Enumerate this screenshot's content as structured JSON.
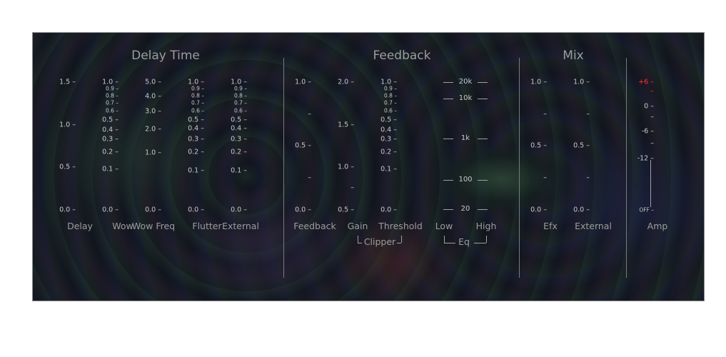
{
  "sections": [
    {
      "id": "delay-time",
      "title": "Delay Time"
    },
    {
      "id": "feedback",
      "title": "Feedback"
    },
    {
      "id": "mix",
      "title": "Mix"
    }
  ],
  "controls": [
    {
      "id": "delay",
      "label": "Delay",
      "ticks": [
        {
          "t": "1.5 –"
        },
        {
          "t": "1.0 –"
        },
        {
          "t": "0.5 –"
        },
        {
          "t": "0.0 –"
        }
      ]
    },
    {
      "id": "wow",
      "label": "Wow",
      "ticks": [
        {
          "t": "1.0 –"
        },
        {
          "t": "0.9 –"
        },
        {
          "t": "0.8 –"
        },
        {
          "t": "0.7 –"
        },
        {
          "t": "0.6 –"
        },
        {
          "t": "0.5 –"
        },
        {
          "t": "0.4 –"
        },
        {
          "t": "0.3 –"
        },
        {
          "t": "0.2 –"
        },
        {
          "t": "0.1 –"
        },
        {
          "t": "0.0 –"
        }
      ]
    },
    {
      "id": "wow-freq",
      "label": "Wow Freq",
      "ticks": [
        {
          "t": "5.0 –"
        },
        {
          "t": "4.0 –"
        },
        {
          "t": "3.0 –"
        },
        {
          "t": "2.0 –"
        },
        {
          "t": "1.0 –"
        },
        {
          "t": "0.0 –"
        }
      ]
    },
    {
      "id": "flutter",
      "label": "Flutter",
      "ticks": [
        {
          "t": "1.0 –"
        },
        {
          "t": "0.9 –"
        },
        {
          "t": "0.8 –"
        },
        {
          "t": "0.7 –"
        },
        {
          "t": "0.6 –"
        },
        {
          "t": "0.5 –"
        },
        {
          "t": "0.4 –"
        },
        {
          "t": "0.3 –"
        },
        {
          "t": "0.2 –"
        },
        {
          "t": "0.1 –"
        },
        {
          "t": "0.0 –"
        }
      ]
    },
    {
      "id": "external-delay",
      "label": "External",
      "ticks": [
        {
          "t": "1.0 –"
        },
        {
          "t": "0.9 –"
        },
        {
          "t": "0.8 –"
        },
        {
          "t": "0.7 –"
        },
        {
          "t": "0.6 –"
        },
        {
          "t": "0.5 –"
        },
        {
          "t": "0.4 –"
        },
        {
          "t": "0.3 –"
        },
        {
          "t": "0.2 –"
        },
        {
          "t": "0.1 –"
        },
        {
          "t": "0.0 –"
        }
      ]
    },
    {
      "id": "feedback",
      "label": "Feedback",
      "ticks": [
        {
          "t": "1.0 –"
        },
        {
          "t": "–"
        },
        {
          "t": "0.5 –"
        },
        {
          "t": "–"
        },
        {
          "t": "0.0 –"
        }
      ]
    },
    {
      "id": "gain",
      "label": "Gain",
      "ticks": [
        {
          "t": "2.0 –"
        },
        {
          "t": "1.5 –"
        },
        {
          "t": "1.0 –"
        },
        {
          "t": "–"
        },
        {
          "t": "0.5 –"
        }
      ]
    },
    {
      "id": "threshold",
      "label": "Threshold",
      "ticks": [
        {
          "t": "1.0 –"
        },
        {
          "t": "0.9 –"
        },
        {
          "t": "0.8 –"
        },
        {
          "t": "0.7 –"
        },
        {
          "t": "0.6 –"
        },
        {
          "t": "0.5 –"
        },
        {
          "t": "0.4 –"
        },
        {
          "t": "0.3 –"
        },
        {
          "t": "0.2 –"
        },
        {
          "t": "0.1 –"
        },
        {
          "t": "0.0 –"
        }
      ]
    },
    {
      "id": "eq",
      "label_low": "Low",
      "label_high": "High",
      "ticks": [
        {
          "t": "20k"
        },
        {
          "t": "10k"
        },
        {
          "t": "1k"
        },
        {
          "t": "100"
        },
        {
          "t": "20"
        }
      ]
    },
    {
      "id": "efx",
      "label": "Efx",
      "ticks": [
        {
          "t": "1.0 –"
        },
        {
          "t": "–"
        },
        {
          "t": "0.5 –"
        },
        {
          "t": "–"
        },
        {
          "t": "0.0 –"
        }
      ]
    },
    {
      "id": "external-mix",
      "label": "External",
      "ticks": [
        {
          "t": "1.0 –"
        },
        {
          "t": "–"
        },
        {
          "t": "0.5 –"
        },
        {
          "t": "–"
        },
        {
          "t": "0.0 –"
        }
      ]
    },
    {
      "id": "amp",
      "label": "Amp",
      "ticks": [
        {
          "t": "+6 –",
          "red": true
        },
        {
          "t": "–",
          "red": true
        },
        {
          "t": "0 –"
        },
        {
          "t": "–"
        },
        {
          "t": "-6 –"
        },
        {
          "t": "–"
        },
        {
          "t": "-12 –"
        },
        {
          "t": "OFF –"
        }
      ]
    }
  ],
  "groups": {
    "clipper": "Clipper",
    "eq": "Eq"
  },
  "colors": {
    "tick": "#c8c8c8",
    "label": "#9c9c9c",
    "red": "#ff3030",
    "separator": "#7a7a7a"
  }
}
